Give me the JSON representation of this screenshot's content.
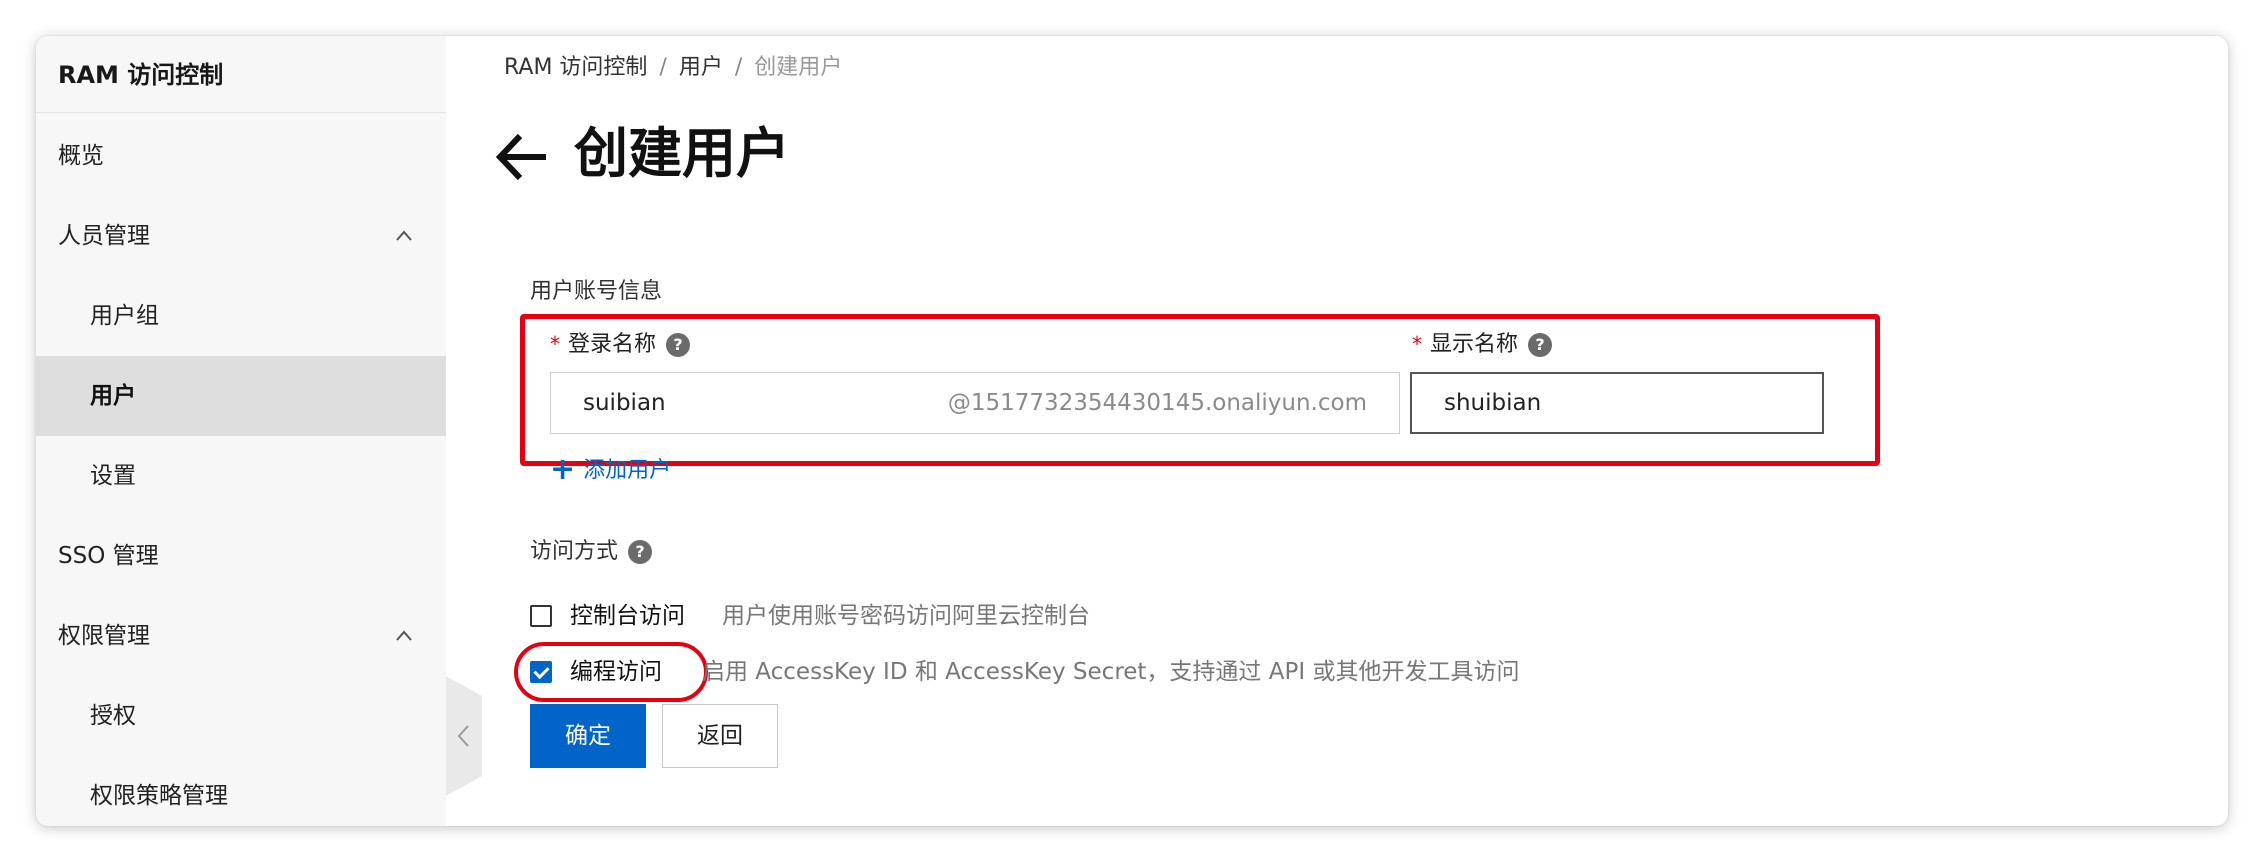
{
  "sidebar": {
    "title": "RAM 访问控制",
    "items": [
      {
        "label": "概览",
        "level": "top",
        "active": false
      },
      {
        "label": "人员管理",
        "level": "top",
        "active": false,
        "expanded": true
      },
      {
        "label": "用户组",
        "level": "sub",
        "active": false
      },
      {
        "label": "用户",
        "level": "sub",
        "active": true
      },
      {
        "label": "设置",
        "level": "sub",
        "active": false
      },
      {
        "label": "SSO 管理",
        "level": "top",
        "active": false
      },
      {
        "label": "权限管理",
        "level": "top",
        "active": false,
        "expanded": true
      },
      {
        "label": "授权",
        "level": "sub",
        "active": false
      },
      {
        "label": "权限策略管理",
        "level": "sub",
        "active": false
      }
    ]
  },
  "breadcrumb": [
    "RAM 访问控制",
    "用户",
    "创建用户"
  ],
  "page": {
    "title": "创建用户"
  },
  "account_section": {
    "label": "用户账号信息",
    "login_name": {
      "label": "登录名称",
      "value": "suibian",
      "suffix": "@1517732354430145.onaliyun.com"
    },
    "display_name": {
      "label": "显示名称",
      "value": "shuibian"
    },
    "add_user_label": "添加用户"
  },
  "access_section": {
    "label": "访问方式",
    "options": [
      {
        "label": "控制台访问",
        "description": "用户使用账号密码访问阿里云控制台",
        "checked": false
      },
      {
        "label": "编程访问",
        "description": "启用 AccessKey ID 和 AccessKey Secret，支持通过 API 或其他开发工具访问",
        "checked": true
      }
    ]
  },
  "actions": {
    "confirm_label": "确定",
    "back_label": "返回"
  },
  "colors": {
    "accent": "#0064c8",
    "annotation": "#e60012",
    "sidebar_bg": "#f7f7f7"
  }
}
